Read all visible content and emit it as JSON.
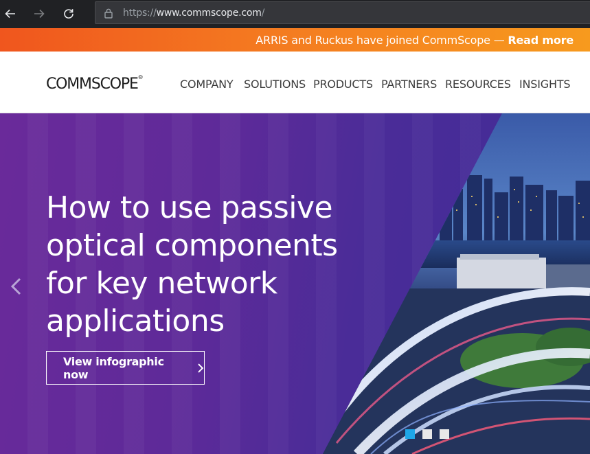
{
  "browser": {
    "url_prefix": "https://",
    "url_host": "www.commscope.com",
    "url_suffix": "/",
    "icons": {
      "back": "arrow-left-icon",
      "forward": "arrow-right-icon",
      "reload": "reload-icon",
      "lock": "lock-icon"
    }
  },
  "announcement": {
    "text": "ARRIS and Ruckus have joined CommScope — ",
    "link_label": "Read more"
  },
  "header": {
    "logo_text": "COMMSCOPE",
    "logo_mark": "®",
    "nav": [
      {
        "label": "COMPANY"
      },
      {
        "label": "SOLUTIONS"
      },
      {
        "label": "PRODUCTS"
      },
      {
        "label": "PARTNERS"
      },
      {
        "label": "RESOURCES"
      },
      {
        "label": "INSIGHTS"
      }
    ]
  },
  "hero": {
    "headline": "How to use passive optical components for key network applications",
    "cta_label": "View infographic now",
    "slides": {
      "count": 3,
      "active_index": 0
    }
  },
  "colors": {
    "accent_orange": "#f47a20",
    "hero_purple": "#5e2a99",
    "active_dot": "#1ea7e8",
    "chrome_dark": "#202124"
  }
}
